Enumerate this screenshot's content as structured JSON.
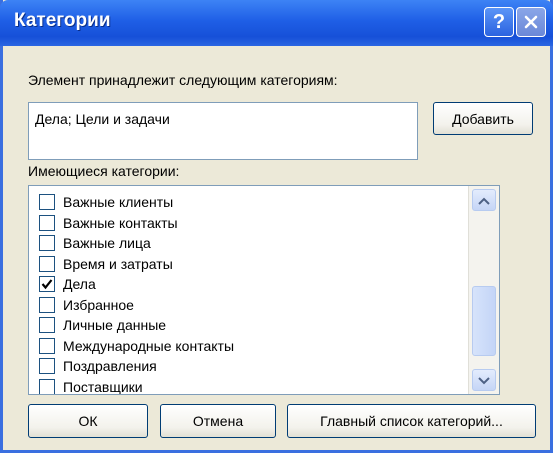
{
  "window": {
    "title": "Категории"
  },
  "assigned": {
    "label": "Элемент принадлежит следующим категориям:",
    "value": "Дела; Цели и задачи",
    "add_button": "Добавить"
  },
  "available": {
    "label": "Имеющиеся категории:",
    "items": [
      {
        "label": "Важные клиенты",
        "checked": false
      },
      {
        "label": "Важные контакты",
        "checked": false
      },
      {
        "label": "Важные лица",
        "checked": false
      },
      {
        "label": "Время и затраты",
        "checked": false
      },
      {
        "label": "Дела",
        "checked": true
      },
      {
        "label": "Избранное",
        "checked": false
      },
      {
        "label": "Личные данные",
        "checked": false
      },
      {
        "label": "Международные контакты",
        "checked": false
      },
      {
        "label": "Поздравления",
        "checked": false
      },
      {
        "label": "Поставщики",
        "checked": false
      }
    ]
  },
  "buttons": {
    "ok": "ОК",
    "cancel": "Отмена",
    "master_list": "Главный список категорий..."
  },
  "icons": {
    "help": "help-icon",
    "close": "close-icon",
    "scroll_up": "chevron-up-icon",
    "scroll_down": "chevron-down-icon",
    "check": "check-icon"
  }
}
